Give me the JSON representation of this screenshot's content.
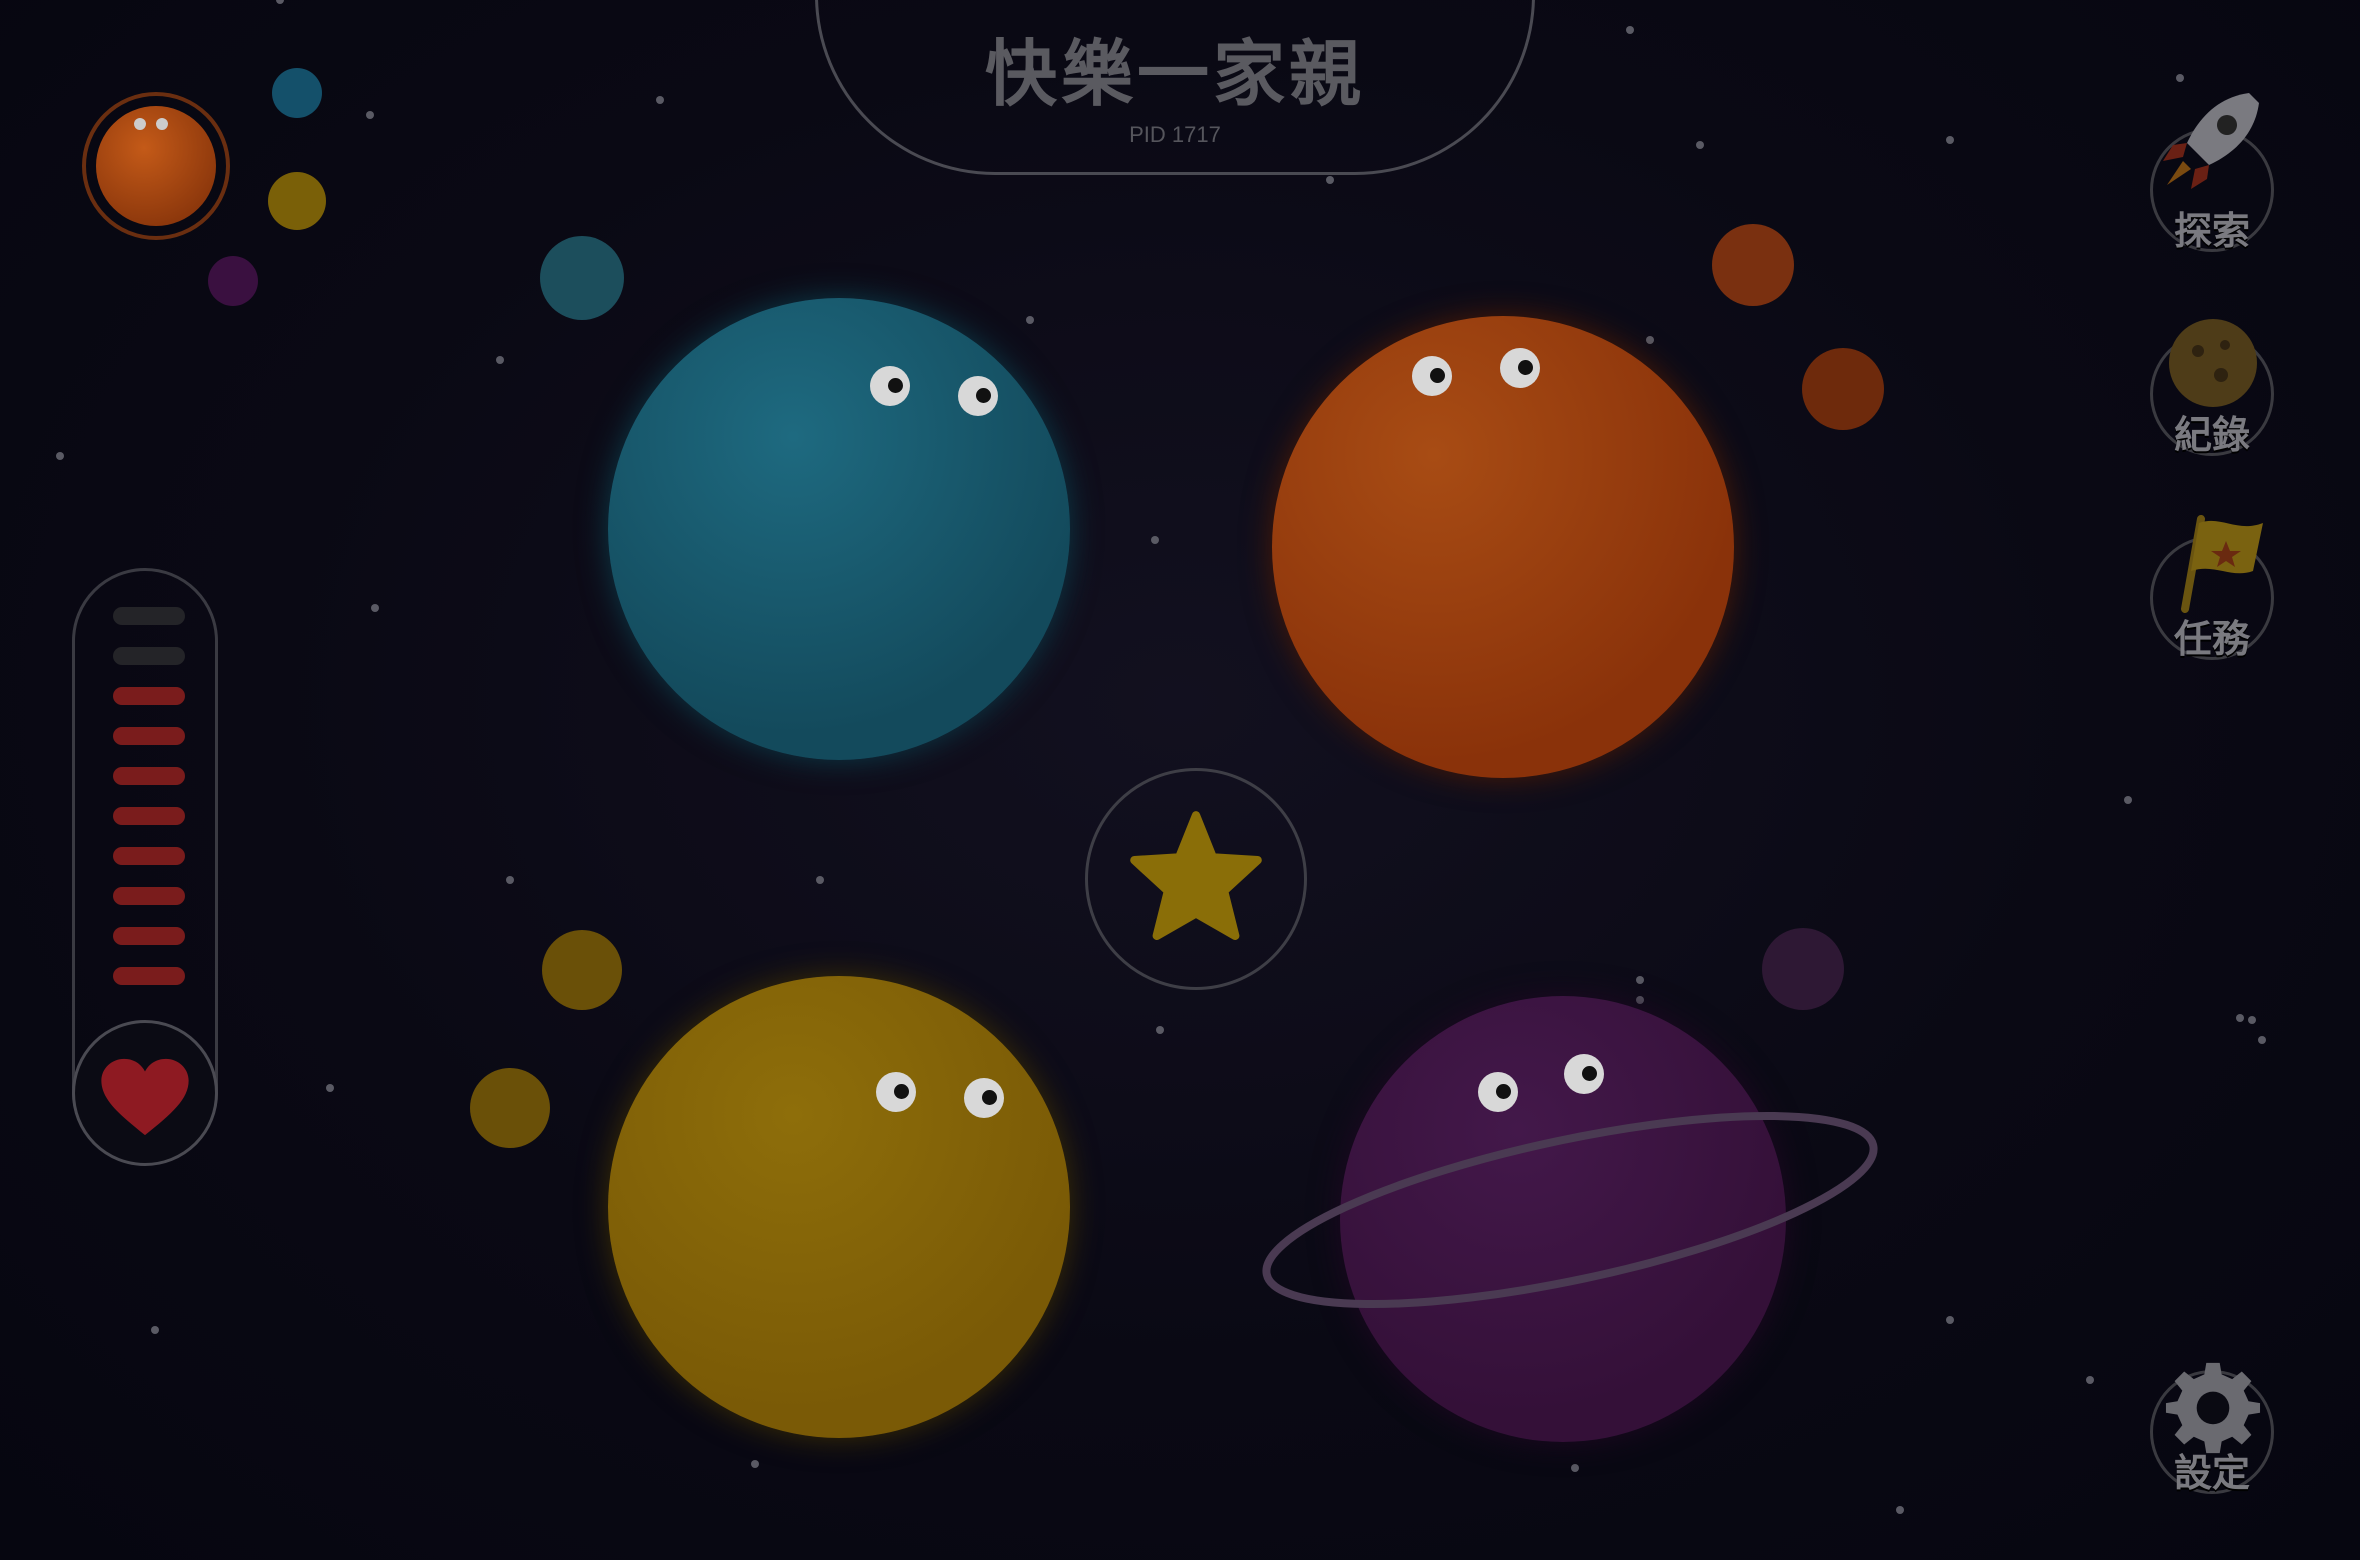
{
  "header": {
    "title": "快樂一家親",
    "pid": "PID 1717"
  },
  "sidebar_right": {
    "explore_label": "探索",
    "records_label": "紀錄",
    "tasks_label": "任務",
    "settings_label": "設定"
  },
  "energy_meter": {
    "segments_total": 10,
    "segments_filled": 8
  },
  "colors": {
    "blue_planet": "#1a5a70",
    "orange_planet": "#a8420f",
    "yellow_planet": "#8a6a08",
    "purple_planet": "#3e1544",
    "bar_filled": "#7a1c1c",
    "bar_empty": "#242428",
    "heart": "#8e1a22"
  },
  "icons": [
    "rocket-icon",
    "cookie-icon",
    "flag-icon",
    "gear-icon",
    "heart-icon",
    "star-icon"
  ]
}
